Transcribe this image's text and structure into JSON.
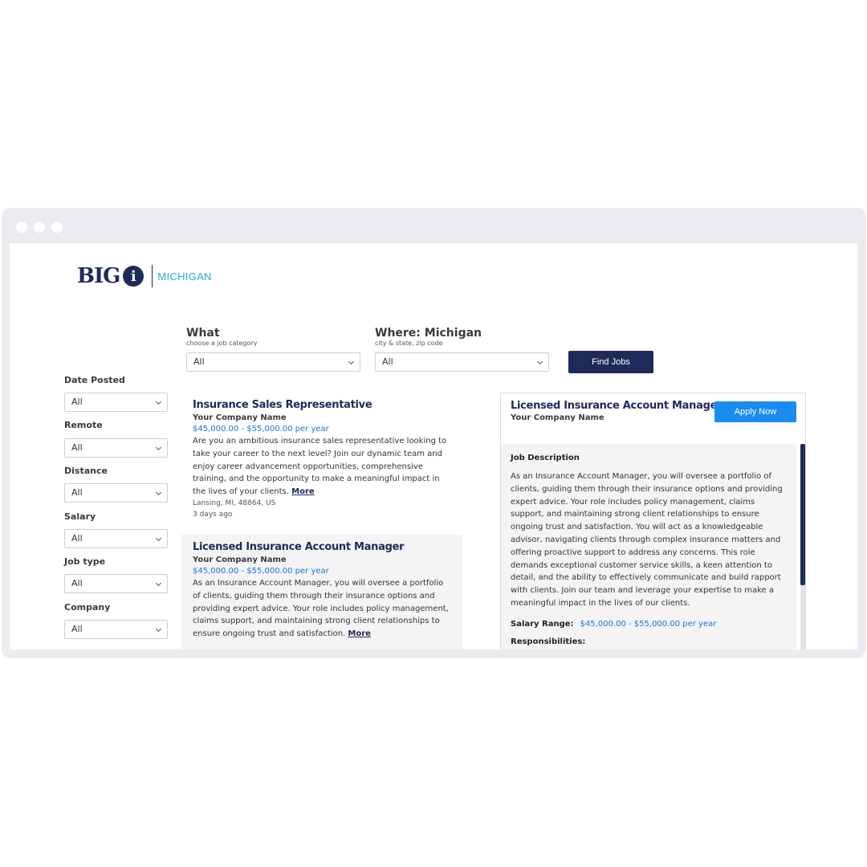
{
  "brand": {
    "logo_big": "BIG",
    "logo_i": "i",
    "logo_state": "MICHIGAN"
  },
  "search": {
    "what_label": "What",
    "what_hint": "choose a job category",
    "what_value": "All",
    "where_label": "Where: Michigan",
    "where_hint": "city & state, zip code",
    "where_value": "All",
    "find_button": "Find Jobs"
  },
  "filters": [
    {
      "label": "Date Posted",
      "value": "All"
    },
    {
      "label": "Remote",
      "value": "All"
    },
    {
      "label": "Distance",
      "value": "All"
    },
    {
      "label": "Salary",
      "value": "All"
    },
    {
      "label": "Job type",
      "value": "All"
    },
    {
      "label": "Company",
      "value": "All"
    }
  ],
  "jobs": [
    {
      "title": "Insurance Sales Representative",
      "company": "Your Company Name",
      "salary": "$45,000.00 - $55,000.00 per year",
      "description": "Are you an ambitious insurance sales representative looking to take your career to the next level? Join our dynamic team and enjoy career advancement opportunities, comprehensive training, and the opportunity to make a meaningful impact in the lives of your clients.",
      "more": "More",
      "location": "Lansing, MI, 48864, US",
      "posted": "3 days ago"
    },
    {
      "title": "Licensed Insurance Account Manager",
      "company": "Your Company Name",
      "salary": "$45,000.00 - $55,000.00 per year",
      "description": "As an Insurance Account Manager, you will oversee a portfolio of clients, guiding them through their insurance options and providing expert advice. Your role includes policy management, claims support, and maintaining strong client relationships to ensure ongoing trust and satisfaction.",
      "more": "More"
    }
  ],
  "detail": {
    "title": "Licensed Insurance Account Manager",
    "company": "Your Company Name",
    "apply_button": "Apply Now",
    "section_heading": "Job Description",
    "description": "As an Insurance Account Manager, you will oversee a portfolio of clients, guiding them through their insurance options and providing expert advice. Your role includes policy management, claims support, and maintaining strong client relationships to ensure ongoing trust and satisfaction. You will act as a knowledgeable advisor, navigating clients through complex insurance matters and offering proactive support to address any concerns. This role demands exceptional customer service skills, a keen attention to detail, and the ability to effectively communicate and build rapport with clients. Join our team and leverage your expertise to make a meaningful impact in the lives of our clients.",
    "salary_label": "Salary Range:",
    "salary_value": "$45,000.00 - $55,000.00 per year",
    "responsibilities_heading": "Responsibilities:"
  }
}
